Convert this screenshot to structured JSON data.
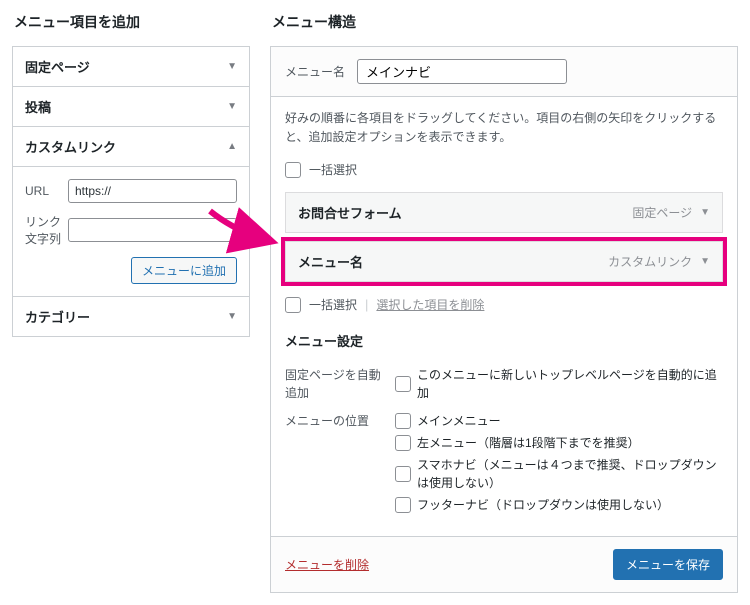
{
  "left": {
    "title": "メニュー項目を追加",
    "accordion": {
      "pages": "固定ページ",
      "posts": "投稿",
      "custom_link": "カスタムリンク",
      "categories": "カテゴリー"
    },
    "custom": {
      "url_label": "URL",
      "url_value": "https://",
      "text_label": "リンク文字列",
      "text_value": "",
      "add_button": "メニューに追加"
    }
  },
  "right": {
    "title": "メニュー構造",
    "menu_name_label": "メニュー名",
    "menu_name_value": "メインナビ",
    "help": "好みの順番に各項目をドラッグしてください。項目の右側の矢印をクリックすると、追加設定オプションを表示できます。",
    "bulk_select": "一括選択",
    "bulk_delete": "選択した項目を削除",
    "items": [
      {
        "title": "お問合せフォーム",
        "type": "固定ページ"
      },
      {
        "title": "メニュー名",
        "type": "カスタムリンク"
      }
    ],
    "settings_title": "メニュー設定",
    "auto_add_label": "固定ページを自動追加",
    "auto_add_option": "このメニューに新しいトップレベルページを自動的に追加",
    "location_label": "メニューの位置",
    "locations": [
      "メインメニュー",
      "左メニュー（階層は1段階下までを推奨）",
      "スマホナビ（メニューは４つまで推奨、ドロップダウンは使用しない）",
      "フッターナビ（ドロップダウンは使用しない）"
    ],
    "delete_menu": "メニューを削除",
    "save_menu": "メニューを保存"
  }
}
